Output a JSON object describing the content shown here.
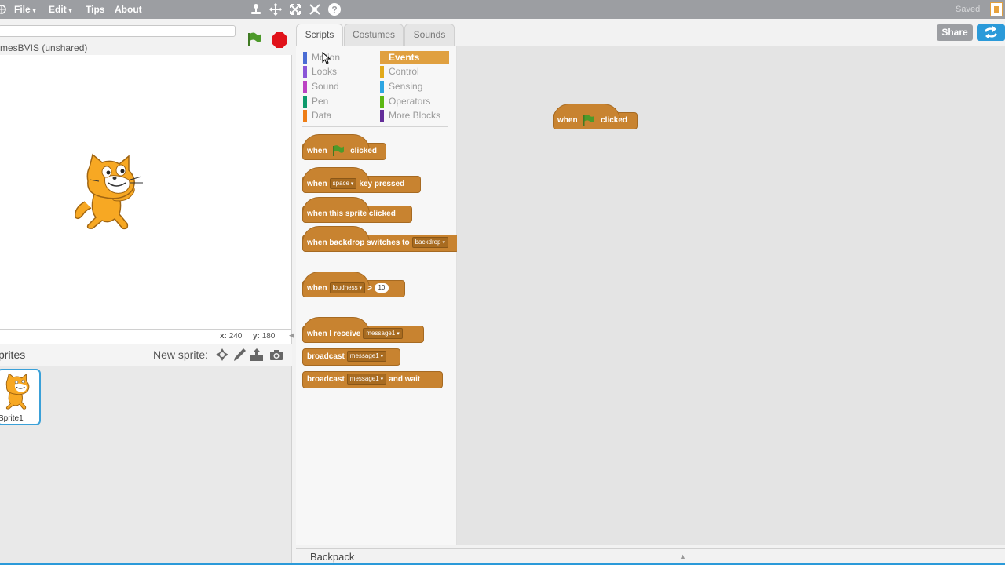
{
  "menu": {
    "file": "File",
    "edit": "Edit",
    "tips": "Tips",
    "about": "About",
    "saved": "Saved"
  },
  "toolbar_icons": [
    "duplicate-icon",
    "cut-icon",
    "grow-icon",
    "shrink-icon",
    "help-icon"
  ],
  "project": {
    "name": "mesBVIS (unshared)"
  },
  "stage": {
    "x_label": "x:",
    "x_value": "240",
    "y_label": "y:",
    "y_value": "180"
  },
  "sprites": {
    "title": "prites",
    "new_sprite_label": "New sprite:",
    "items": [
      {
        "label": "Sprite1"
      }
    ]
  },
  "tabs": [
    {
      "label": "Scripts",
      "active": true
    },
    {
      "label": "Costumes",
      "active": false
    },
    {
      "label": "Sounds",
      "active": false
    }
  ],
  "categories": [
    {
      "label": "Motion",
      "color": "#4a6cd4"
    },
    {
      "label": "Looks",
      "color": "#8a55d7"
    },
    {
      "label": "Sound",
      "color": "#bb42c3"
    },
    {
      "label": "Pen",
      "color": "#0e9a6c"
    },
    {
      "label": "Data",
      "color": "#ee7d16"
    },
    {
      "label": "Events",
      "color": "#c88330",
      "active": true
    },
    {
      "label": "Control",
      "color": "#e1a91a"
    },
    {
      "label": "Sensing",
      "color": "#2ca5e2"
    },
    {
      "label": "Operators",
      "color": "#5cb712"
    },
    {
      "label": "More Blocks",
      "color": "#632d99"
    }
  ],
  "blocks": {
    "when_flag": {
      "pre": "when",
      "post": "clicked"
    },
    "when_key": {
      "pre": "when",
      "key": "space",
      "post": "key pressed"
    },
    "when_sprite_clicked": {
      "text": "when this sprite clicked"
    },
    "when_backdrop": {
      "pre": "when backdrop switches to",
      "value": "backdrop"
    },
    "when_loudness": {
      "pre": "when",
      "sensor": "loudness",
      "op": ">",
      "value": "10"
    },
    "when_receive": {
      "pre": "when I receive",
      "message": "message1"
    },
    "broadcast": {
      "pre": "broadcast",
      "message": "message1"
    },
    "broadcast_wait": {
      "pre": "broadcast",
      "message": "message1",
      "post": "and wait"
    }
  },
  "script_blocks": {
    "when_flag": {
      "pre": "when",
      "post": "clicked"
    }
  },
  "share": {
    "label": "Share"
  },
  "backpack": {
    "label": "Backpack"
  }
}
